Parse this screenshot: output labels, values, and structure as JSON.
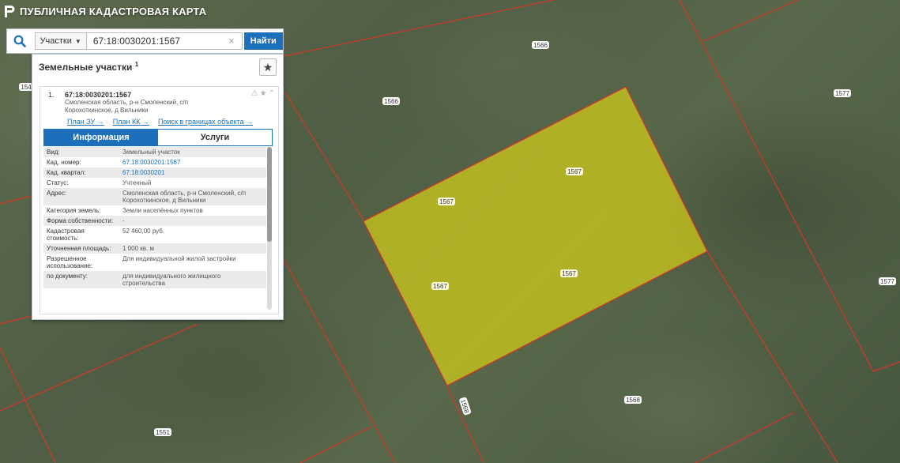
{
  "app": {
    "title": "ПУБЛИЧНАЯ КАДАСТРОВАЯ КАРТА"
  },
  "search": {
    "type_label": "Участки",
    "value": "67:18:0030201:1567",
    "clear_glyph": "×",
    "find_label": "Найти"
  },
  "panel": {
    "title": "Земельные участки",
    "count": "1",
    "bookmark_glyph": "★"
  },
  "result": {
    "index": "1.",
    "title": "67:18:0030201:1567",
    "address_line1": "Смоленская область, р-н Смоленский, с/п",
    "address_line2": "Корохоткинское, д Вильники",
    "icons": [
      "warning-icon",
      "star-icon",
      "chevron-up-icon"
    ],
    "links": {
      "plan_zu": "План ЗУ →",
      "plan_kk": "План КК →",
      "search_bounds": "Поиск в границах объекта →"
    }
  },
  "tabs": {
    "info": "Информация",
    "services": "Услуги"
  },
  "info": {
    "view": {
      "label": "Вид:",
      "value": "Земельный участок"
    },
    "cad_number": {
      "label": "Кад. номер:",
      "value": "67:18:0030201:1567"
    },
    "cad_quarter": {
      "label": "Кад. квартал:",
      "value": "67:18:0030201"
    },
    "status": {
      "label": "Статус:",
      "value": "Учтенный"
    },
    "address": {
      "label": "Адрес:",
      "value": "Смоленская область, р-н Смоленский, с/п Корохоткинское, д Вильники"
    },
    "land_category": {
      "label": "Категория земель:",
      "value": "Земли населённых пунктов"
    },
    "ownership": {
      "label": "Форма собственности:",
      "value": "-"
    },
    "cad_cost": {
      "label": "Кадастровая стоимость:",
      "value": "52 460,00 руб."
    },
    "area": {
      "label": "Уточненная площадь:",
      "value": "1 000 кв. м"
    },
    "permitted_use": {
      "label": "Разрешенное использование:",
      "value": "Для индивидуальной жилой застройки"
    },
    "by_document": {
      "label": "по документу:",
      "value": "для индивидуального жилищного строительства"
    }
  },
  "map": {
    "parcel_color": "#c9c51e",
    "boundary_color": "#d9342b",
    "labels": {
      "l1566a": "1566",
      "l1566b": "1566",
      "l1577a": "1577",
      "l1577b": "1577",
      "l1567a": "1567",
      "l1567b": "1567",
      "l1567c": "1567",
      "l1567d": "1567",
      "l1568a": "1568",
      "l1568b": "1568",
      "l1551": "1551",
      "l154": "154"
    }
  },
  "colors": {
    "accent": "#1c6fba"
  }
}
